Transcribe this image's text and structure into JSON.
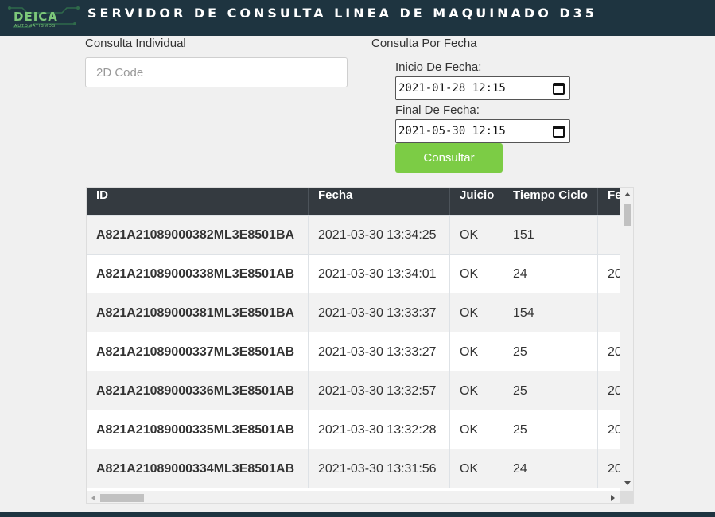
{
  "header": {
    "logo_text": "DEICA",
    "logo_subtext": "AUTOMATISMOS",
    "title": "SERVIDOR DE CONSULTA LINEA DE MAQUINADO D35"
  },
  "individual": {
    "label": "Consulta Individual",
    "placeholder": "2D Code"
  },
  "by_date": {
    "label": "Consulta Por Fecha",
    "start_label": "Inicio De Fecha:",
    "start_value": "2021-01-28 12:15",
    "end_label": "Final De Fecha:",
    "end_value": "2021-05-30 12:15",
    "submit_label": "Consultar"
  },
  "table": {
    "columns": [
      "ID",
      "Fecha",
      "Juicio",
      "Tiempo Ciclo",
      "Fe"
    ],
    "rows": [
      {
        "id": "A821A21089000382ML3E8501BA",
        "fecha": "2021-03-30 13:34:25",
        "juicio": "OK",
        "tiempo": "151",
        "fe": ""
      },
      {
        "id": "A821A21089000338ML3E8501AB",
        "fecha": "2021-03-30 13:34:01",
        "juicio": "OK",
        "tiempo": "24",
        "fe": "20"
      },
      {
        "id": "A821A21089000381ML3E8501BA",
        "fecha": "2021-03-30 13:33:37",
        "juicio": "OK",
        "tiempo": "154",
        "fe": ""
      },
      {
        "id": "A821A21089000337ML3E8501AB",
        "fecha": "2021-03-30 13:33:27",
        "juicio": "OK",
        "tiempo": "25",
        "fe": "20"
      },
      {
        "id": "A821A21089000336ML3E8501AB",
        "fecha": "2021-03-30 13:32:57",
        "juicio": "OK",
        "tiempo": "25",
        "fe": "20"
      },
      {
        "id": "A821A21089000335ML3E8501AB",
        "fecha": "2021-03-30 13:32:28",
        "juicio": "OK",
        "tiempo": "25",
        "fe": "20"
      },
      {
        "id": "A821A21089000334ML3E8501AB",
        "fecha": "2021-03-30 13:31:56",
        "juicio": "OK",
        "tiempo": "24",
        "fe": "20"
      }
    ]
  },
  "icons": {
    "calendar": "calendar-icon",
    "scroll_up": "chevron-up-icon",
    "scroll_down": "chevron-down-icon",
    "scroll_left": "chevron-left-icon",
    "scroll_right": "chevron-right-icon"
  },
  "colors": {
    "header_bg": "#1e3440",
    "logo": "#7dc77a",
    "button": "#7ccc45",
    "table_header": "#343a40"
  }
}
